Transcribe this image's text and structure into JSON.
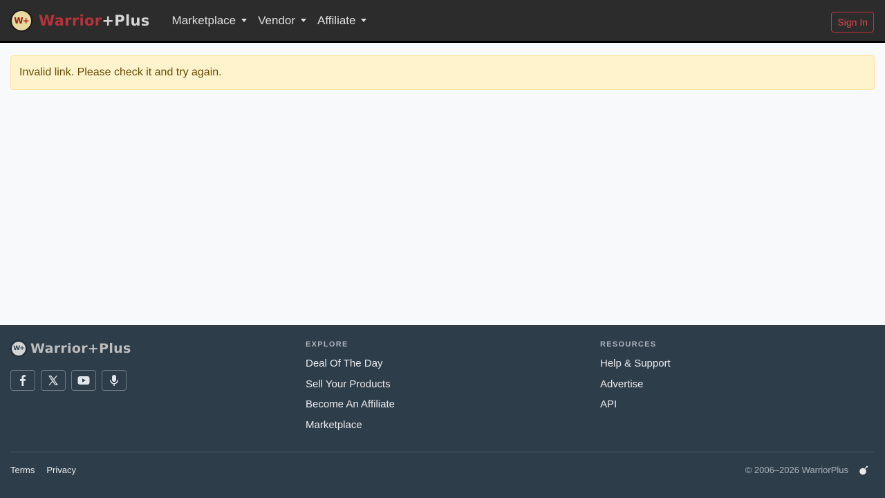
{
  "navbar": {
    "brand_badge": "W+",
    "brand_part1": "Warrior",
    "brand_part2": "+Plus",
    "menu": [
      {
        "label": "Marketplace"
      },
      {
        "label": "Vendor"
      },
      {
        "label": "Affiliate"
      }
    ],
    "signin_label": "Sign In"
  },
  "alert": {
    "message": "Invalid link. Please check it and try again."
  },
  "footer": {
    "brand_badge": "W+",
    "brand_part1": "Warrior",
    "brand_part2": "+Plus",
    "socials": [
      {
        "icon": "facebook-icon"
      },
      {
        "icon": "x-twitter-icon"
      },
      {
        "icon": "youtube-icon"
      },
      {
        "icon": "microphone-icon"
      }
    ],
    "explore": {
      "heading": "EXPLORE",
      "links": [
        "Deal Of The Day",
        "Sell Your Products",
        "Become An Affiliate",
        "Marketplace"
      ]
    },
    "resources": {
      "heading": "RESOURCES",
      "links": [
        "Help & Support",
        "Advertise",
        "API"
      ]
    },
    "bottom_links": [
      "Terms",
      "Privacy"
    ],
    "copyright": "© 2006–2026 WarriorPlus"
  },
  "colors": {
    "navbar_bg": "#2c2c2c",
    "brand_red": "#b5333a",
    "signin_red": "#e04652",
    "alert_bg": "#fff3cd",
    "alert_text": "#664d03",
    "footer_bg": "#2e3d4a"
  }
}
